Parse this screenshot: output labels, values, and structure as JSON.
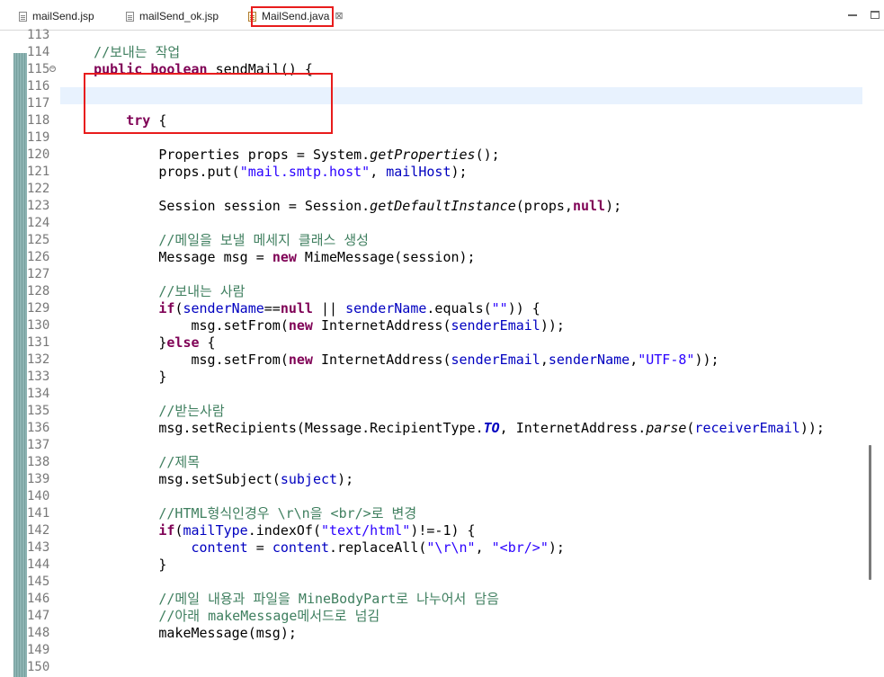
{
  "tabs": [
    {
      "label": "mailSend.jsp",
      "icon": "jsp-file-icon"
    },
    {
      "label": "mailSend_ok.jsp",
      "icon": "jsp-file-icon"
    },
    {
      "label": "MailSend.java",
      "icon": "java-file-icon",
      "active": true,
      "close": "⊠"
    }
  ],
  "editor": {
    "current_line": 116,
    "lines": [
      {
        "n": "113",
        "t": ""
      },
      {
        "n": "114",
        "t": "    //보내는 작업"
      },
      {
        "n": "115",
        "t": "    public boolean sendMail() {"
      },
      {
        "n": "116",
        "t": ""
      },
      {
        "n": "117",
        "t": ""
      },
      {
        "n": "118",
        "t": "        try {"
      },
      {
        "n": "119",
        "t": ""
      },
      {
        "n": "120",
        "t": "            Properties props = System.getProperties();"
      },
      {
        "n": "121",
        "t": "            props.put(\"mail.smtp.host\", mailHost);"
      },
      {
        "n": "122",
        "t": ""
      },
      {
        "n": "123",
        "t": "            Session session = Session.getDefaultInstance(props,null);"
      },
      {
        "n": "124",
        "t": ""
      },
      {
        "n": "125",
        "t": "            //메일을 보낼 메세지 클래스 생성"
      },
      {
        "n": "126",
        "t": "            Message msg = new MimeMessage(session);"
      },
      {
        "n": "127",
        "t": ""
      },
      {
        "n": "128",
        "t": "            //보내는 사람"
      },
      {
        "n": "129",
        "t": "            if(senderName==null || senderName.equals(\"\")) {"
      },
      {
        "n": "130",
        "t": "                msg.setFrom(new InternetAddress(senderEmail));"
      },
      {
        "n": "131",
        "t": "            }else {"
      },
      {
        "n": "132",
        "t": "                msg.setFrom(new InternetAddress(senderEmail,senderName,\"UTF-8\"));"
      },
      {
        "n": "133",
        "t": "            }"
      },
      {
        "n": "134",
        "t": ""
      },
      {
        "n": "135",
        "t": "            //받는사람"
      },
      {
        "n": "136",
        "t": "            msg.setRecipients(Message.RecipientType.TO, InternetAddress.parse(receiverEmail));"
      },
      {
        "n": "137",
        "t": ""
      },
      {
        "n": "138",
        "t": "            //제목"
      },
      {
        "n": "139",
        "t": "            msg.setSubject(subject);"
      },
      {
        "n": "140",
        "t": ""
      },
      {
        "n": "141",
        "t": "            //HTML형식인경우 \\r\\n을 <br/>로 변경"
      },
      {
        "n": "142",
        "t": "            if(mailType.indexOf(\"text/html\")!=-1) {"
      },
      {
        "n": "143",
        "t": "                content = content.replaceAll(\"\\r\\n\", \"<br/>\");"
      },
      {
        "n": "144",
        "t": "            }"
      },
      {
        "n": "145",
        "t": ""
      },
      {
        "n": "146",
        "t": "            //메일 내용과 파일을 MineBodyPart로 나누어서 담음"
      },
      {
        "n": "147",
        "t": "            //아래 makeMessage메서드로 넘김"
      },
      {
        "n": "148",
        "t": "            makeMessage(msg);"
      },
      {
        "n": "149",
        "t": ""
      },
      {
        "n": "150",
        "t": ""
      }
    ]
  },
  "colors": {
    "keyword": "#7f0055",
    "comment": "#3f7f5f",
    "string": "#2a00ff",
    "field": "#0000c0",
    "highlight_box": "#e81c1c",
    "current_line": "#e8f2fe"
  }
}
